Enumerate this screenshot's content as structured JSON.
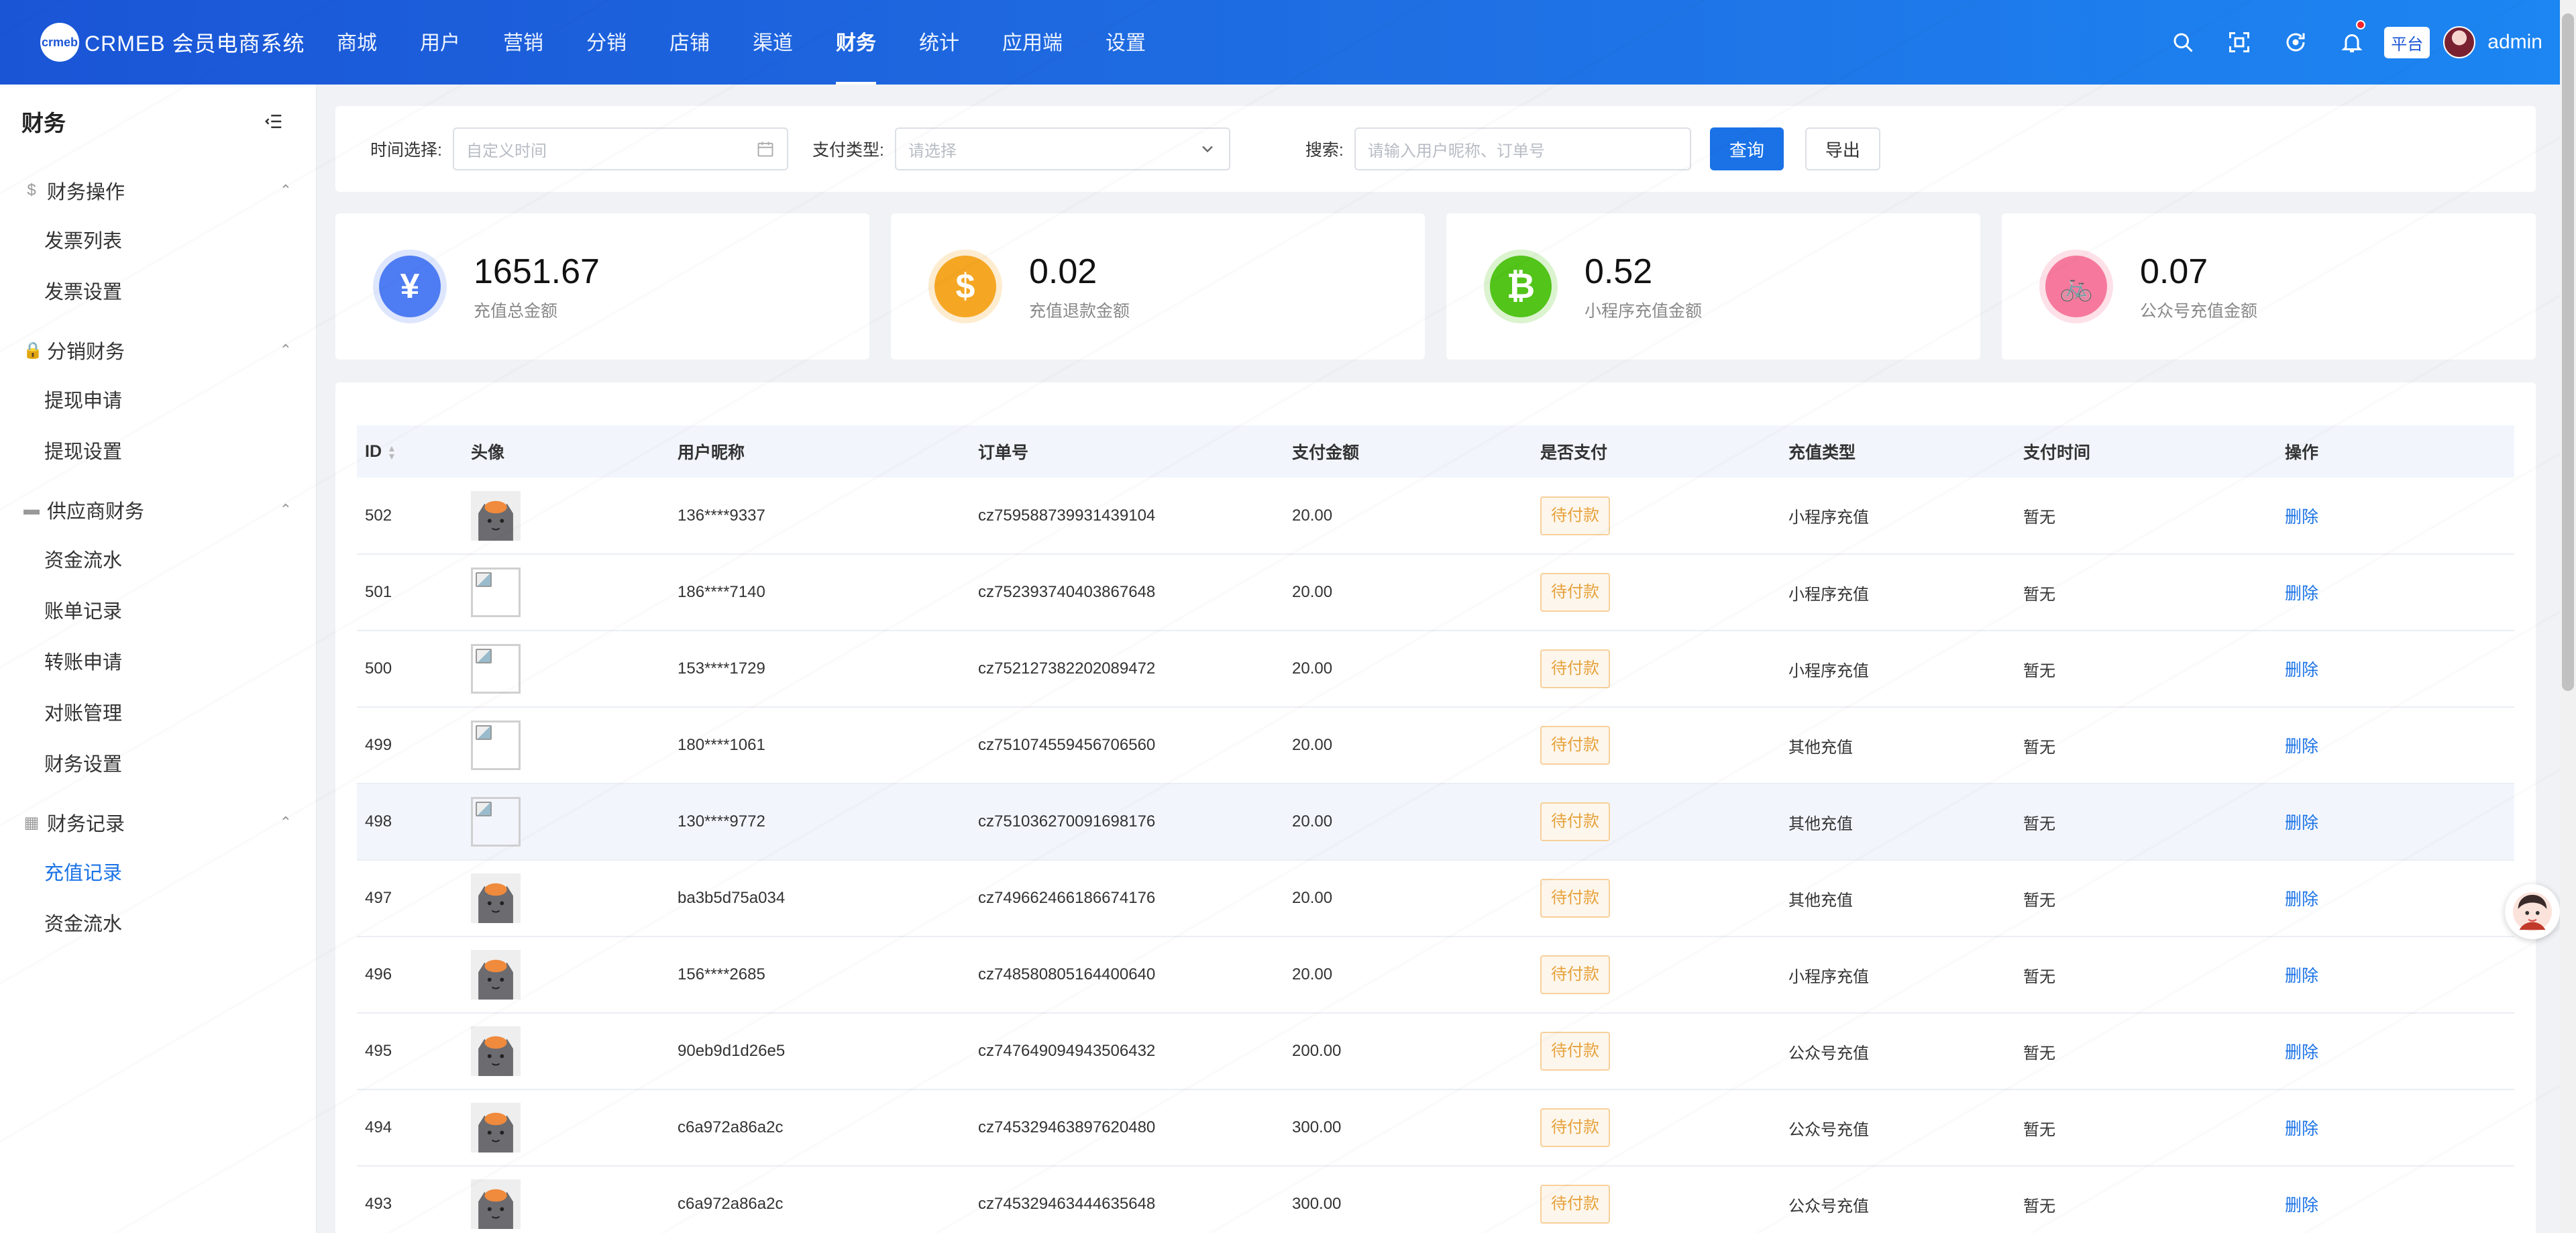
{
  "app": {
    "logo_mark": "crmeb",
    "title": "CRMEB 会员电商系统"
  },
  "nav": {
    "items": [
      "商城",
      "用户",
      "营销",
      "分销",
      "店铺",
      "渠道",
      "财务",
      "统计",
      "应用端",
      "设置"
    ],
    "active": "财务"
  },
  "topbar": {
    "platform_label": "平台",
    "user_name": "admin"
  },
  "sidebar": {
    "title": "财务",
    "groups": [
      {
        "label": "财务操作",
        "icon": "dollar-icon",
        "items": [
          "发票列表",
          "发票设置"
        ]
      },
      {
        "label": "分销财务",
        "icon": "lock-icon",
        "items": [
          "提现申请",
          "提现设置"
        ]
      },
      {
        "label": "供应商财务",
        "icon": "card-icon",
        "items": [
          "资金流水",
          "账单记录",
          "转账申请",
          "对账管理",
          "财务设置"
        ]
      },
      {
        "label": "财务记录",
        "icon": "doc-icon",
        "items": [
          "充值记录",
          "资金流水"
        ]
      }
    ],
    "active_item": "充值记录"
  },
  "filters": {
    "time_label": "时间选择:",
    "time_placeholder": "自定义时间",
    "pay_type_label": "支付类型:",
    "pay_type_placeholder": "请选择",
    "search_label": "搜索:",
    "search_placeholder": "请输入用户昵称、订单号",
    "query_button": "查询",
    "export_button": "导出"
  },
  "stats": [
    {
      "value": "1651.67",
      "label": "充值总金额",
      "icon": "yen-icon",
      "color": "#4e7cf2",
      "ring": "#dde6fd"
    },
    {
      "value": "0.02",
      "label": "充值退款金额",
      "icon": "dollar-icon",
      "color": "#f5a623",
      "ring": "#fdecd0"
    },
    {
      "value": "0.52",
      "label": "小程序充值金额",
      "icon": "bitcoin-icon",
      "color": "#52c41a",
      "ring": "#dbf3cf"
    },
    {
      "value": "0.07",
      "label": "公众号充值金额",
      "icon": "bike-icon",
      "color": "#f6799d",
      "ring": "#fde0e8"
    }
  ],
  "table": {
    "columns": [
      "ID",
      "头像",
      "用户昵称",
      "订单号",
      "支付金额",
      "是否支付",
      "充值类型",
      "支付时间",
      "操作"
    ],
    "rows": [
      {
        "id": "502",
        "avatar": "cat",
        "nickname": "136****9337",
        "order_no": "cz759588739931439104",
        "amount": "20.00",
        "paid": "待付款",
        "type": "小程序充值",
        "pay_time": "暂无",
        "op": "删除"
      },
      {
        "id": "501",
        "avatar": "broken",
        "nickname": "186****7140",
        "order_no": "cz752393740403867648",
        "amount": "20.00",
        "paid": "待付款",
        "type": "小程序充值",
        "pay_time": "暂无",
        "op": "删除"
      },
      {
        "id": "500",
        "avatar": "broken",
        "nickname": "153****1729",
        "order_no": "cz752127382202089472",
        "amount": "20.00",
        "paid": "待付款",
        "type": "小程序充值",
        "pay_time": "暂无",
        "op": "删除"
      },
      {
        "id": "499",
        "avatar": "broken",
        "nickname": "180****1061",
        "order_no": "cz751074559456706560",
        "amount": "20.00",
        "paid": "待付款",
        "type": "其他充值",
        "pay_time": "暂无",
        "op": "删除"
      },
      {
        "id": "498",
        "avatar": "broken",
        "nickname": "130****9772",
        "order_no": "cz751036270091698176",
        "amount": "20.00",
        "paid": "待付款",
        "type": "其他充值",
        "pay_time": "暂无",
        "op": "删除"
      },
      {
        "id": "497",
        "avatar": "cat",
        "nickname": "ba3b5d75a034",
        "order_no": "cz749662466186674176",
        "amount": "20.00",
        "paid": "待付款",
        "type": "其他充值",
        "pay_time": "暂无",
        "op": "删除"
      },
      {
        "id": "496",
        "avatar": "cat",
        "nickname": "156****2685",
        "order_no": "cz748580805164400640",
        "amount": "20.00",
        "paid": "待付款",
        "type": "小程序充值",
        "pay_time": "暂无",
        "op": "删除"
      },
      {
        "id": "495",
        "avatar": "cat",
        "nickname": "90eb9d1d26e5",
        "order_no": "cz747649094943506432",
        "amount": "200.00",
        "paid": "待付款",
        "type": "公众号充值",
        "pay_time": "暂无",
        "op": "删除"
      },
      {
        "id": "494",
        "avatar": "cat",
        "nickname": "c6a972a86a2c",
        "order_no": "cz745329463897620480",
        "amount": "300.00",
        "paid": "待付款",
        "type": "公众号充值",
        "pay_time": "暂无",
        "op": "删除"
      },
      {
        "id": "493",
        "avatar": "cat",
        "nickname": "c6a972a86a2c",
        "order_no": "cz745329463444635648",
        "amount": "300.00",
        "paid": "待付款",
        "type": "公众号充值",
        "pay_time": "暂无",
        "op": "删除"
      }
    ],
    "hover_row_id": "498"
  }
}
